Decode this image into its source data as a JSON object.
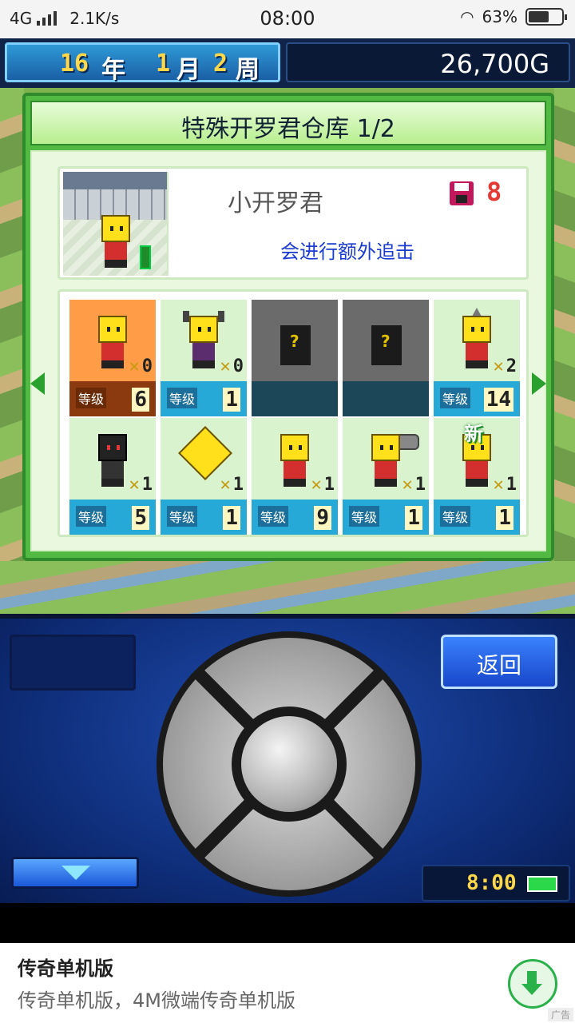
{
  "status_bar": {
    "network": "4G",
    "speed": "2.1K/s",
    "time": "08:00",
    "battery": "63%",
    "battery_level": 0.63
  },
  "hud": {
    "year_num": "16",
    "year_unit": "年",
    "month_num": "1",
    "month_unit": "月",
    "week_num": "2",
    "week_unit": "周",
    "money": "26,700G"
  },
  "dialog": {
    "title": "特殊开罗君仓库 1/2",
    "selected": {
      "name": "小开罗君",
      "count": "8",
      "description": "会进行额外追击"
    },
    "level_label": "等级",
    "new_tag": "新",
    "slots": [
      {
        "sprite": "yellow-kairo",
        "qty": "0",
        "level": "6",
        "state": "selected"
      },
      {
        "sprite": "devil-kairo",
        "qty": "0",
        "level": "1",
        "state": "normal"
      },
      {
        "sprite": "locked",
        "qty": "",
        "level": "",
        "state": "locked"
      },
      {
        "sprite": "locked",
        "qty": "",
        "level": "",
        "state": "locked"
      },
      {
        "sprite": "drill-kairo",
        "qty": "2",
        "level": "14",
        "state": "normal"
      },
      {
        "sprite": "ninja-kairo",
        "qty": "1",
        "level": "5",
        "state": "normal"
      },
      {
        "sprite": "diamond-kairo",
        "qty": "1",
        "level": "1",
        "state": "normal"
      },
      {
        "sprite": "rocket-kairo",
        "qty": "1",
        "level": "9",
        "state": "normal"
      },
      {
        "sprite": "tank-kairo",
        "qty": "1",
        "level": "1",
        "state": "normal"
      },
      {
        "sprite": "chef-kairo",
        "qty": "1",
        "level": "1",
        "state": "new"
      }
    ]
  },
  "controller": {
    "back_label": "返回",
    "clock": "8:00"
  },
  "ad": {
    "title": "传奇单机版",
    "description": "传奇单机版，4M微端传奇单机版",
    "tag": "广告"
  },
  "colors": {
    "dialog_green": "#52b943",
    "level_blue": "#27a9d8",
    "selected_orange": "#ff9c47",
    "money_bg": "#0a1a36"
  }
}
